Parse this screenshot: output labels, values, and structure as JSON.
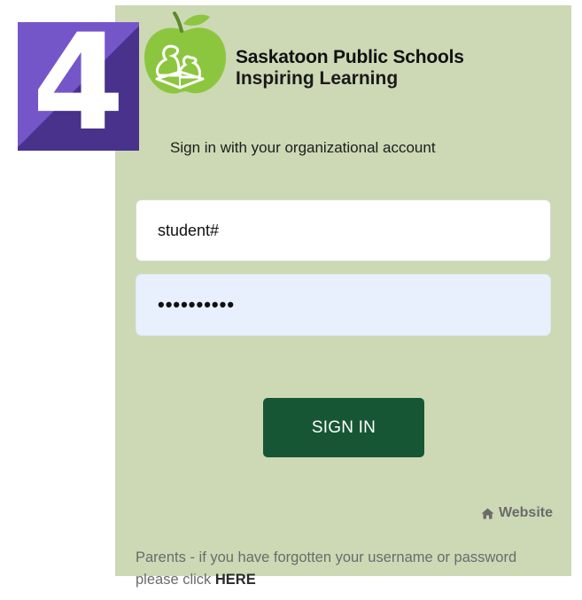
{
  "step_badge": {
    "digit": "4",
    "color": "#7556c9"
  },
  "brand": {
    "name": "Saskatoon Public Schools",
    "tagline": "Inspiring Learning",
    "logo_icon": "apple-reading-logo-icon",
    "logo_color": "#8cc63f"
  },
  "signin": {
    "caption": "Sign in with your organizational account",
    "username_value": "student#",
    "password_value": "••••••••••",
    "button_label": "SIGN IN",
    "button_color": "#175634"
  },
  "links": {
    "website_icon": "home-icon",
    "website_label": "Website",
    "help_prefix": "Parents - if you have forgotten your username or password please click ",
    "help_link": "HERE"
  },
  "colors": {
    "panel_background": "#ccd9b4",
    "password_autofill": "#e8f0fe"
  }
}
